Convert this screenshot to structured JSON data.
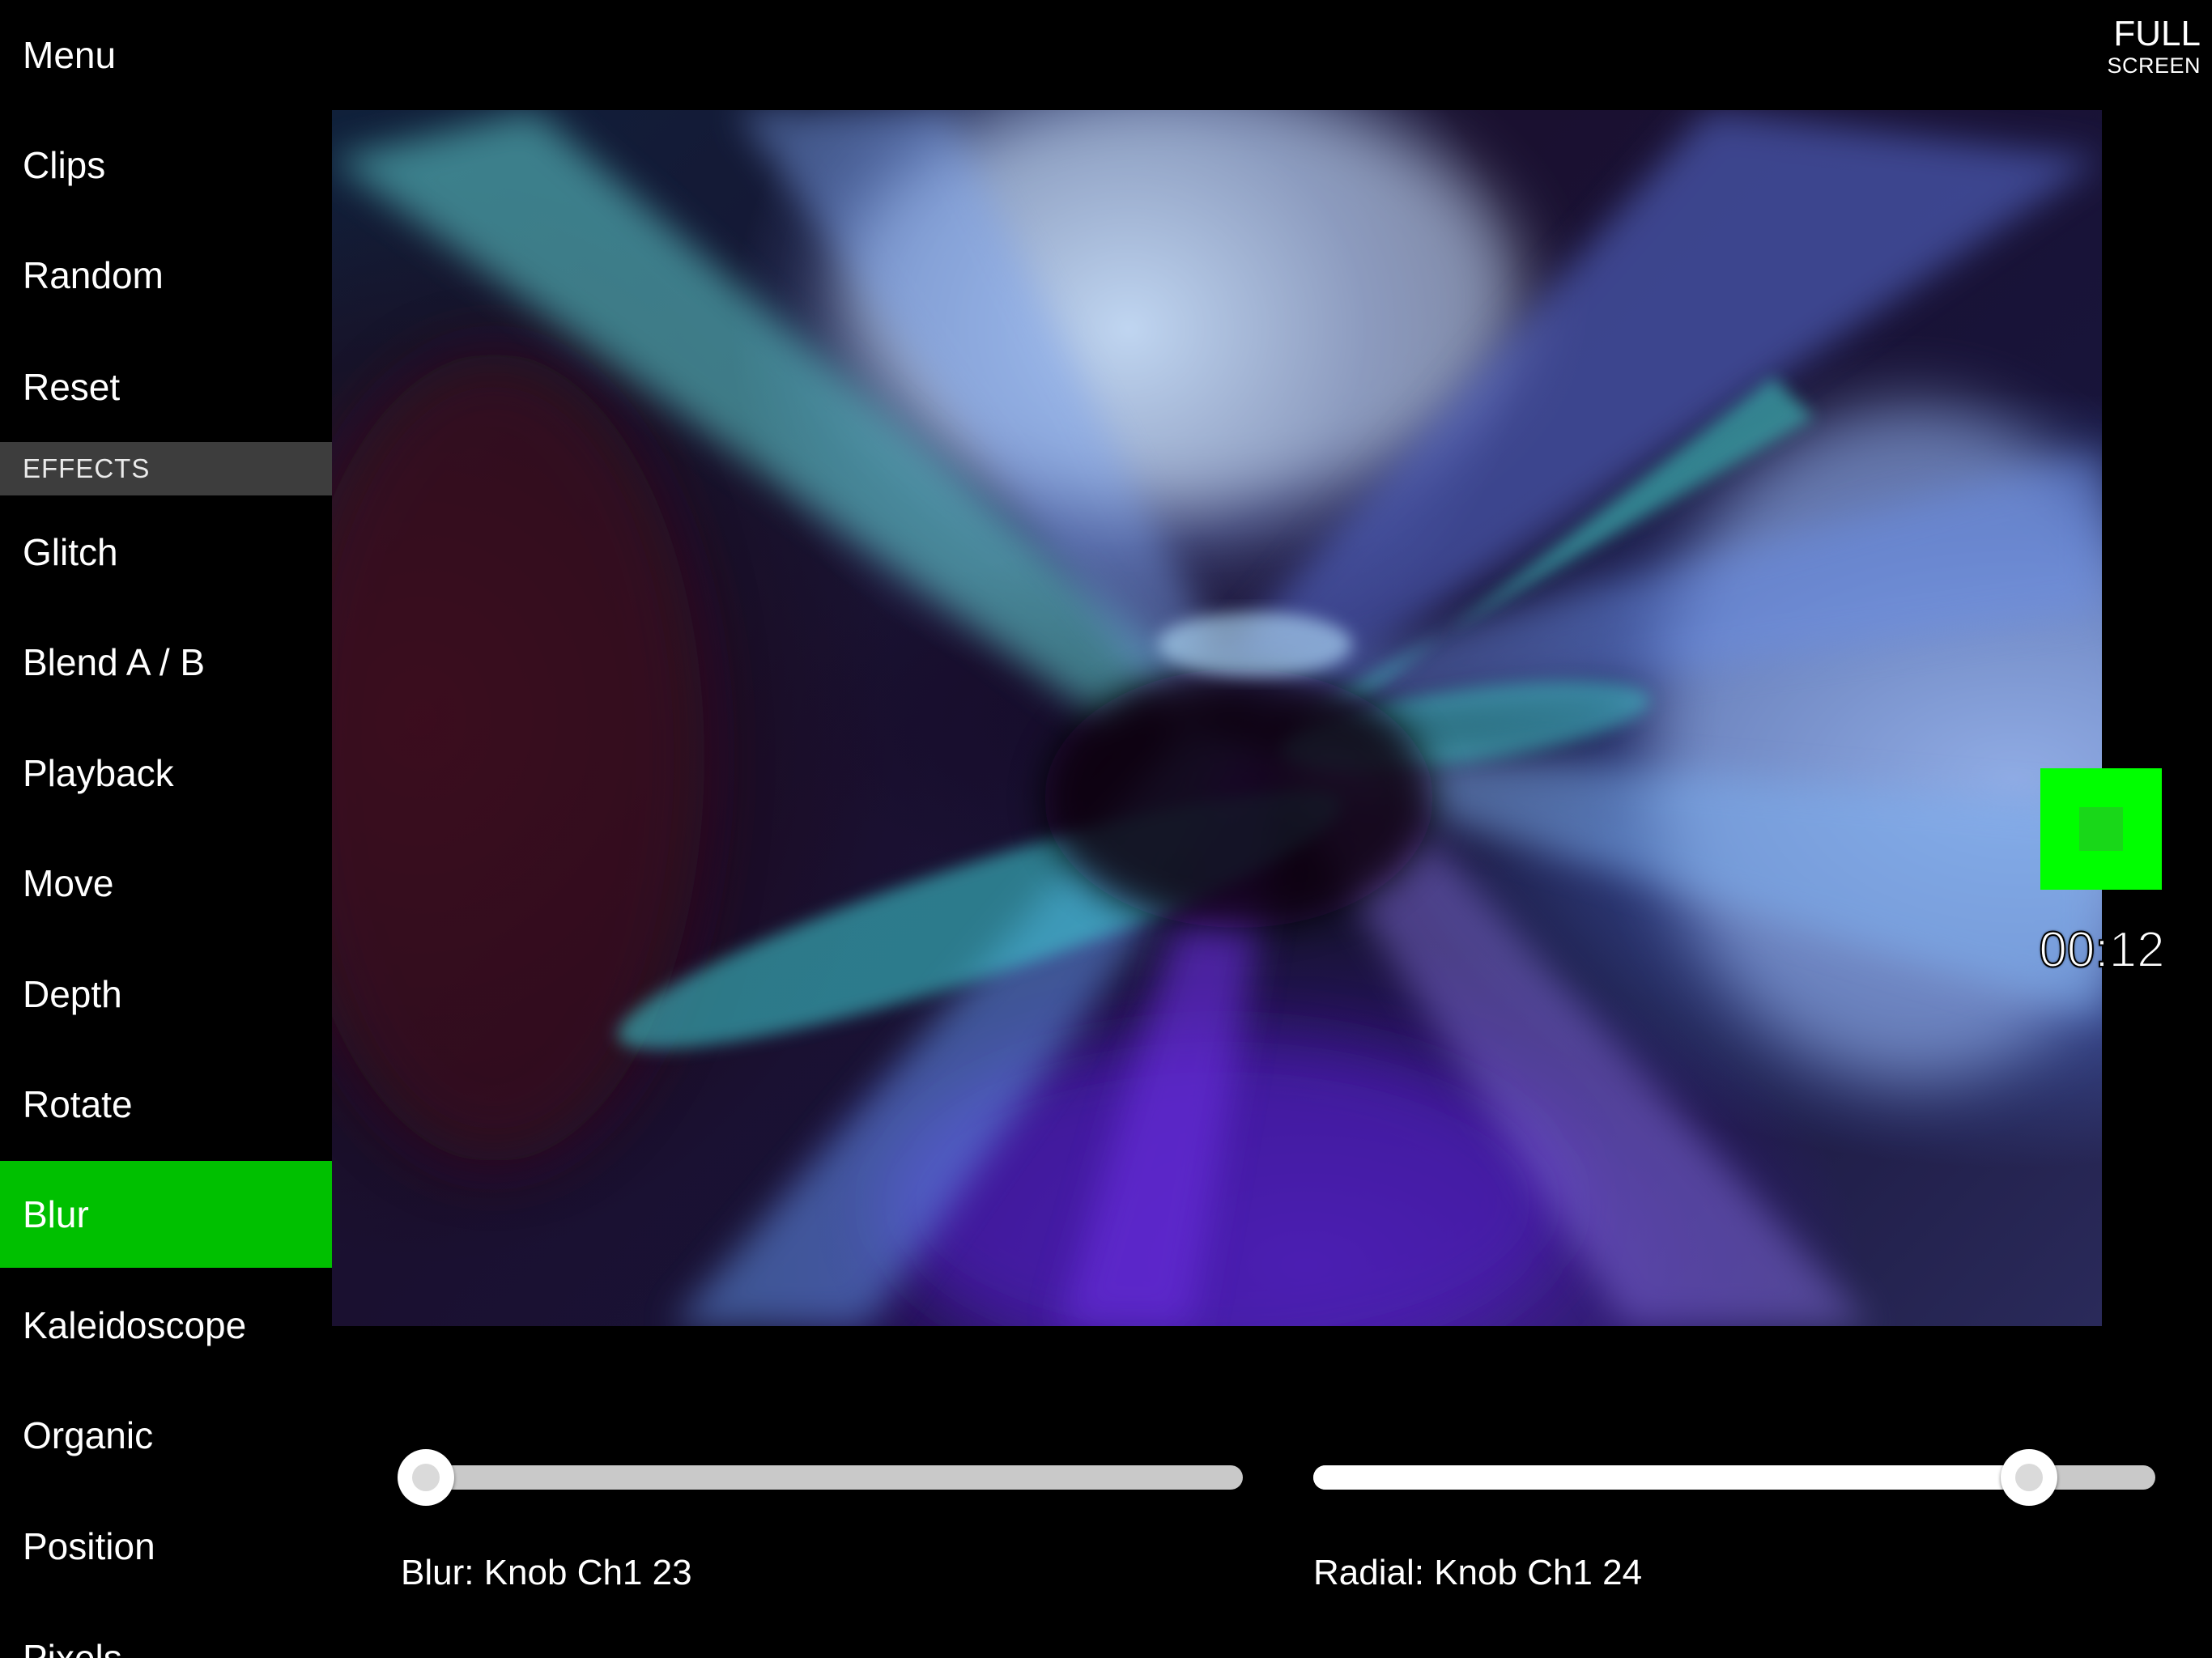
{
  "sidebar": {
    "items": [
      {
        "label": "Menu"
      },
      {
        "label": "Clips"
      },
      {
        "label": "Random"
      },
      {
        "label": "Reset"
      }
    ],
    "section_header": "EFFECTS",
    "effects": [
      {
        "label": "Glitch"
      },
      {
        "label": "Blend A / B"
      },
      {
        "label": "Playback"
      },
      {
        "label": "Move"
      },
      {
        "label": "Depth"
      },
      {
        "label": "Rotate"
      },
      {
        "label": "Blur",
        "active": true
      },
      {
        "label": "Kaleidoscope"
      },
      {
        "label": "Organic"
      },
      {
        "label": "Position"
      },
      {
        "label": "Pixels"
      }
    ]
  },
  "fullscreen": {
    "line1": "FULL",
    "line2": "SCREEN"
  },
  "recorder": {
    "time": "00:12"
  },
  "sliders": [
    {
      "label": "Blur: Knob Ch1 23",
      "value": 0.03
    },
    {
      "label": "Radial: Knob Ch1 24",
      "value": 0.85
    }
  ],
  "colors": {
    "active": "#00c000",
    "record": "#00ff00",
    "header_bg": "#3d3d3d"
  }
}
